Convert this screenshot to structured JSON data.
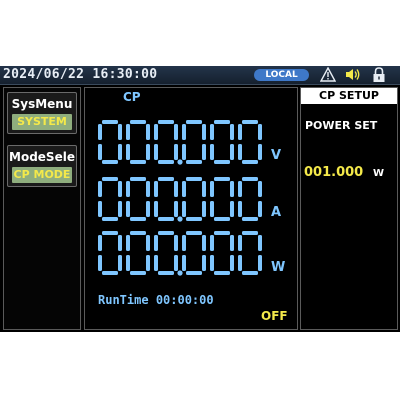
{
  "status_bar": {
    "datetime": "2024/06/22 16:30:00",
    "remote_badge": "LOCAL",
    "icons": [
      "warning-icon",
      "speaker-icon",
      "lock-icon"
    ]
  },
  "left_menu": {
    "sysmenu_title": "SysMenu",
    "sysmenu_value": "SYSTEM",
    "modesele_title": "ModeSele",
    "modesele_value": "CP MODE"
  },
  "meter": {
    "mode": "CP",
    "voltage": "000.000",
    "voltage_unit": "V",
    "current": "000.000",
    "current_unit": "A",
    "power": "000.000",
    "power_unit": "W",
    "runtime_label": "RunTime",
    "runtime_value": "00:00:00",
    "output_state": "OFF"
  },
  "setup": {
    "title": "CP SETUP",
    "power_set_label": "POWER SET",
    "power_set_value": "001.000",
    "power_set_unit": "W"
  },
  "colors": {
    "digit": "#7fc6ff",
    "accent": "#f4e94a",
    "badge": "#3e78c8"
  }
}
